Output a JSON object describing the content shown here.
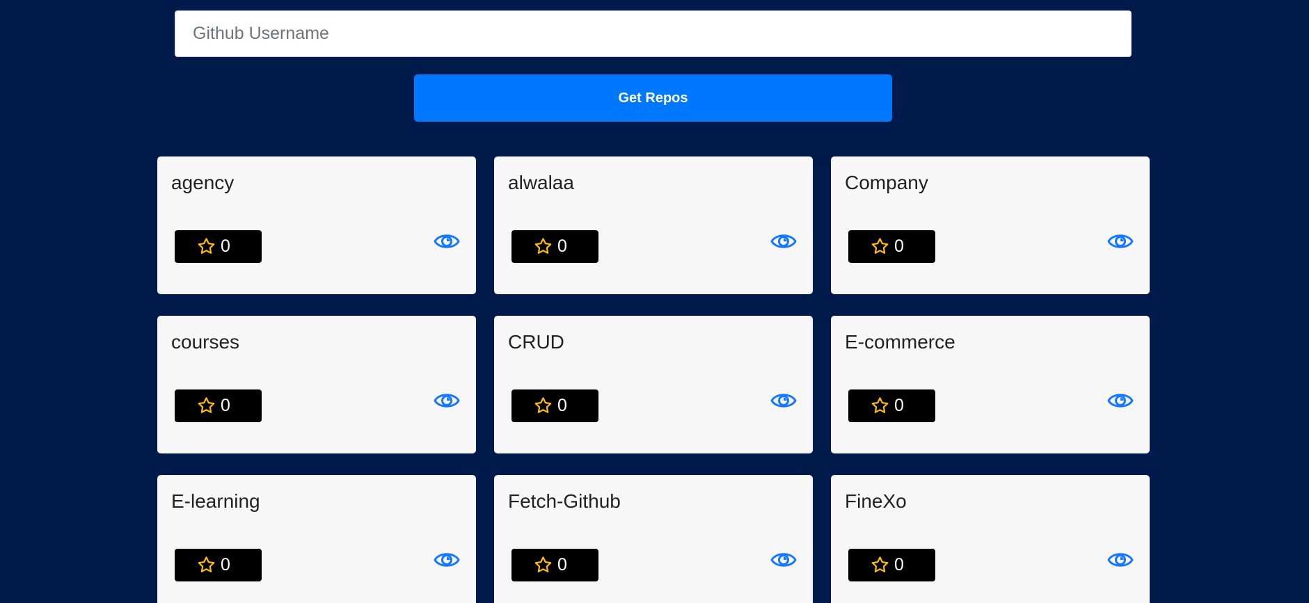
{
  "search": {
    "placeholder": "Github Username",
    "value": ""
  },
  "action": {
    "get_repos_label": "Get Repos"
  },
  "colors": {
    "background": "#001a4b",
    "button": "#0077ff",
    "card": "#f7f7f7",
    "star": "#ffc107",
    "eye": "#1677ff"
  },
  "repos": [
    {
      "name": "agency",
      "stars": "0"
    },
    {
      "name": "alwalaa",
      "stars": "0"
    },
    {
      "name": "Company",
      "stars": "0"
    },
    {
      "name": "courses",
      "stars": "0"
    },
    {
      "name": "CRUD",
      "stars": "0"
    },
    {
      "name": "E-commerce",
      "stars": "0"
    },
    {
      "name": "E-learning",
      "stars": "0"
    },
    {
      "name": "Fetch-Github",
      "stars": "0"
    },
    {
      "name": "FineXo",
      "stars": "0"
    }
  ],
  "icons": {
    "star": "star-icon",
    "view": "eye-icon"
  }
}
